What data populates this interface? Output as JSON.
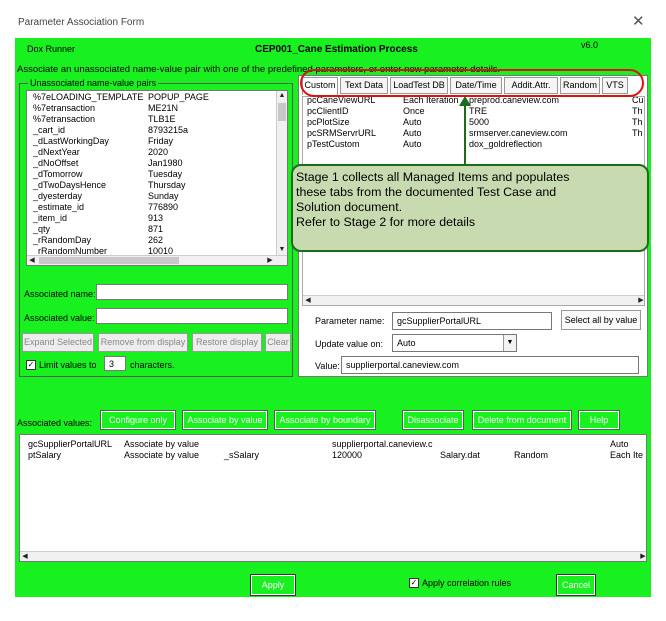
{
  "window": {
    "title": "Parameter Association Form",
    "close_glyph": "✕"
  },
  "header": {
    "left": "Dox Runner",
    "center": "CEP001_Cane Estimation Process",
    "version": "v6.0"
  },
  "instruction": "Associate an unassociated name-value pair with one of the predefined parameters, or enter new parameter details.",
  "unassociated": {
    "legend": "Unassociated name-value pairs",
    "rows": [
      {
        "name": "%7eLOADING_TEMPLATE",
        "value": "POPUP_PAGE"
      },
      {
        "name": "%7etransaction",
        "value": "ME21N"
      },
      {
        "name": "%7etransaction",
        "value": "TLB1E"
      },
      {
        "name": "_cart_id",
        "value": "8793215a"
      },
      {
        "name": "_dLastWorkingDay",
        "value": "Friday"
      },
      {
        "name": "_dNextYear",
        "value": "2020"
      },
      {
        "name": "_dNoOffset",
        "value": "Jan1980"
      },
      {
        "name": "_dTomorrow",
        "value": "Tuesday"
      },
      {
        "name": "_dTwoDaysHence",
        "value": "Thursday"
      },
      {
        "name": "_dyesterday",
        "value": "Sunday"
      },
      {
        "name": "_estimate_id",
        "value": "776890"
      },
      {
        "name": "_item_id",
        "value": "913"
      },
      {
        "name": "_qty",
        "value": "871"
      },
      {
        "name": "_rRandomDay",
        "value": "262"
      },
      {
        "name": "_rRandomNumber",
        "value": "10010"
      }
    ]
  },
  "assoc_form": {
    "name_label": "Associated name:",
    "value_label": "Associated value:",
    "name_value": "",
    "value_value": "",
    "btn_expand": "Expand Selected",
    "btn_remove": "Remove from display",
    "btn_restore": "Restore display",
    "btn_clear": "Clear",
    "limit_label": "Limit values to",
    "limit_value": "3",
    "limit_suffix": "characters.",
    "limit_checked": "✓"
  },
  "tabs": [
    {
      "label": "Custom"
    },
    {
      "label": "Text Data"
    },
    {
      "label": "LoadTest DB"
    },
    {
      "label": "Date/Time"
    },
    {
      "label": "Addit.Attr."
    },
    {
      "label": "Random"
    },
    {
      "label": "VTS"
    }
  ],
  "params": {
    "rows": [
      {
        "c1": "pcCaneViewURL",
        "c2": "Each Iteration",
        "c3": "preprod.caneview.com",
        "c4": "Cu"
      },
      {
        "c1": "pcClientID",
        "c2": "Once",
        "c3": "TRE",
        "c4": "Th"
      },
      {
        "c1": "pcPlotSize",
        "c2": "Auto",
        "c3": "5000",
        "c4": "Th"
      },
      {
        "c1": "pcSRMServrURL",
        "c2": "Auto",
        "c3": "srmserver.caneview.com",
        "c4": "Th"
      },
      {
        "c1": "pTestCustom",
        "c2": "Auto",
        "c3": "dox_goldreflection",
        "c4": ""
      }
    ],
    "param_name_label": "Parameter name:",
    "param_name_value": "gcSupplierPortalURL",
    "select_all_btn": "Select all by value",
    "update_label": "Update value on:",
    "update_value": "Auto",
    "value_label": "Value:",
    "value_value": "supplierportal.caneview.com"
  },
  "callout": {
    "line1": "Stage 1 collects all Managed Items and populates",
    "line2": "these tabs from the documented Test Case and",
    "line3": "Solution document.",
    "line4": "Refer to Stage 2 for more details"
  },
  "associated": {
    "label": "Associated values:",
    "btn_configure": "Configure only",
    "btn_by_value": "Associate by value",
    "btn_by_boundary": "Associate by boundary",
    "btn_disassociate": "Disassociate",
    "btn_delete": "Delete from document",
    "btn_help": "Help",
    "rows": [
      {
        "c1": "gcSupplierPortalURL",
        "c2": "Associate by value",
        "c3": "",
        "c4": "supplierportal.caneview.c",
        "c5": "",
        "c6": "",
        "c7": "Auto"
      },
      {
        "c1": "ptSalary",
        "c2": "Associate by value",
        "c3": "_sSalary",
        "c4": "120000",
        "c5": "Salary.dat",
        "c6": "Random",
        "c7": "Each Ite"
      }
    ]
  },
  "footer": {
    "apply": "Apply",
    "correlation_label": "Apply correlation rules",
    "correlation_checked": "✓",
    "cancel": "Cancel"
  },
  "colors": {
    "form_bg": "#19f01f",
    "callout_bg": "#c8dbb0",
    "callout_border": "#1d6b1d",
    "oval": "#e01010"
  }
}
